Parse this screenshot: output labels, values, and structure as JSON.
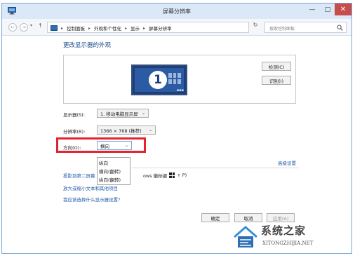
{
  "window": {
    "title": "屏幕分辨率",
    "min_glyph": "—",
    "max_glyph": "□",
    "close_glyph": "✕"
  },
  "address_bar": {
    "back_glyph": "←",
    "forward_glyph": "→",
    "recent_glyph": "▾",
    "up_glyph": "↑",
    "crumbs": [
      "控制面板",
      "外观和个性化",
      "显示",
      "屏幕分辨率"
    ],
    "separator": "▸",
    "dropdown_glyph": "▾",
    "refresh_glyph": "↻",
    "search_placeholder": "搜索控制面板"
  },
  "main": {
    "heading": "更改显示器的外观",
    "monitor_number": "1",
    "monitor_dots": "▪▪▪",
    "detect_button": "检测(C)",
    "identify_button": "识别(I)",
    "display_label": "显示器(S):",
    "display_value": "1. 移动电脑显示屏",
    "resolution_label": "分辨率(R):",
    "resolution_value": "1366 × 768 (推荐)",
    "orientation_label": "方向(O):",
    "orientation_value": "横向",
    "caret": "⌄",
    "orientation_options": [
      "纵向",
      "横向(翻转)",
      "纵向(翻转)"
    ],
    "advanced_link": "高级设置",
    "project_link": "投影到第二屏幕",
    "project_tail": "ows 徽标键",
    "project_tail_end": "+ P)",
    "text_size_link": "放大或缩小文本和其他项目",
    "choose_link": "我应该选择什么显示器设置?"
  },
  "footer": {
    "ok": "确定",
    "cancel": "取消",
    "apply": "应用(A)"
  },
  "watermark": {
    "main": "系统之家",
    "sub": "XITONGZHIJIA.NET"
  },
  "colors": {
    "accent_link": "#1e5aa8",
    "highlight_box": "#e3232f",
    "close_button": "#c74d4d"
  }
}
